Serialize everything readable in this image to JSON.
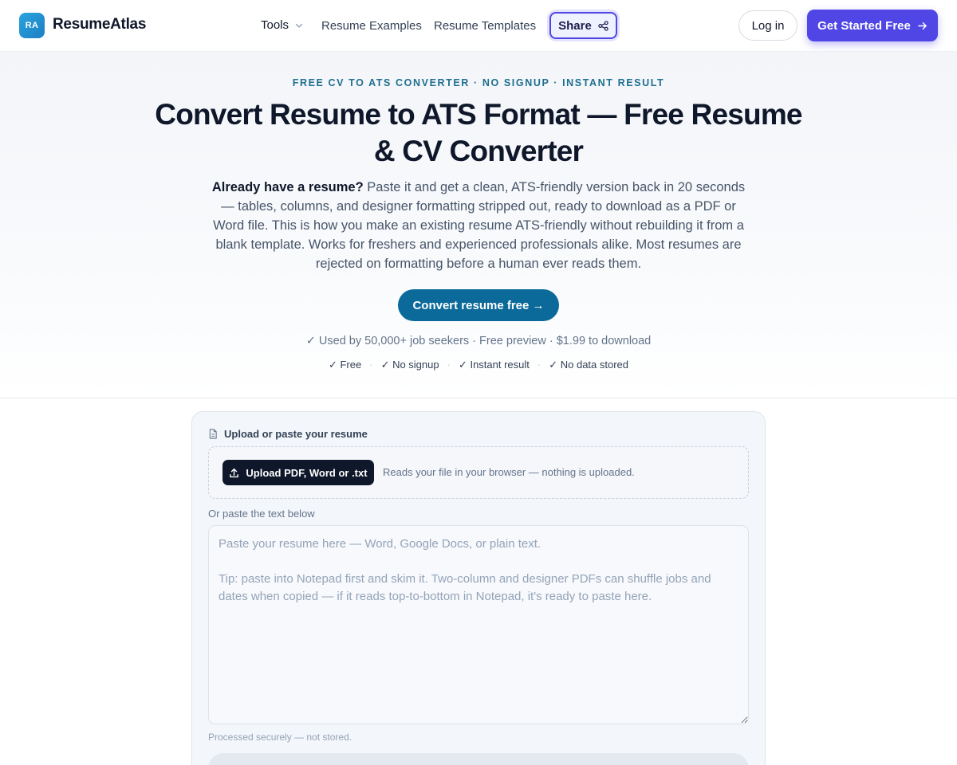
{
  "header": {
    "logo_badge": "RA",
    "brand": "ResumeAtlas",
    "nav": {
      "tools_label": "Tools",
      "examples_label": "Resume Examples",
      "templates_label": "Resume Templates",
      "share_label": "Share"
    },
    "login_label": "Log in",
    "cta_label": "Get Started Free",
    "colors": {
      "accent": "#4f46e5",
      "logo_gradient_start": "#2aa3dd",
      "logo_gradient_end": "#1d7fc4"
    }
  },
  "hero": {
    "eyebrow": "FREE CV TO ATS CONVERTER · NO SIGNUP · INSTANT RESULT",
    "title": "Convert Resume to ATS Format — Free Resume & CV Converter",
    "desc_lead": "Already have a resume?",
    "desc_body": " Paste it and get a clean, ATS-friendly version back in 20 seconds — tables, columns, and designer formatting stripped out, ready to download as a PDF or Word file. This is how you make an existing resume ATS-friendly without rebuilding it from a blank template. Works for freshers and experienced professionals alike. Most resumes are rejected on formatting before a human ever reads them.",
    "convert_label": "Convert resume free →",
    "social_proof": "✓ Used by 50,000+ job seekers · Free preview · $1.99 to download",
    "badges": [
      "✓ Free",
      "✓ No signup",
      "✓ Instant result",
      "✓ No data stored"
    ],
    "badge_separator": "·",
    "colors": {
      "eyebrow": "#1e6f8f",
      "convert_button": "#0b6a9a"
    }
  },
  "card": {
    "label": "Upload or paste your resume",
    "upload_label": "Upload PDF, Word or .txt",
    "upload_note": "Reads your file in your browser — nothing is uploaded.",
    "paste_label": "Or paste the text below",
    "textarea_value": "",
    "textarea_placeholder": "Paste your resume here — Word, Google Docs, or plain text.\n\nTip: paste into Notepad first and skim it. Two-column and designer PDFs can shuffle jobs and dates when copied — if it reads top-to-bottom in Notepad, it's ready to paste here.",
    "processed_note": "Processed securely — not stored.",
    "icons": {
      "label_icon": "document-icon",
      "upload_icon": "upload-icon"
    }
  }
}
